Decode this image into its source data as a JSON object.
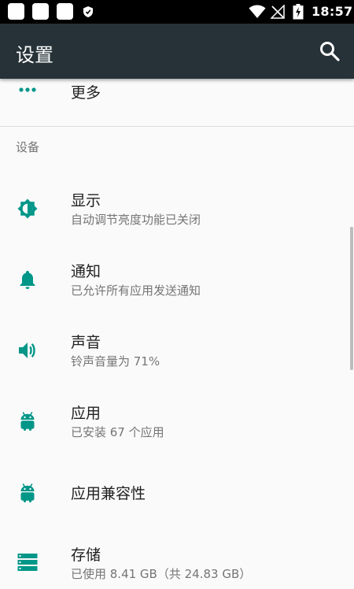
{
  "status_bar": {
    "time": "18:57"
  },
  "app_bar": {
    "title": "设置"
  },
  "more": {
    "label": "更多"
  },
  "section": {
    "header": "设备"
  },
  "items": [
    {
      "title": "显示",
      "summary": "自动调节亮度功能已关闭",
      "icon": "brightness-icon"
    },
    {
      "title": "通知",
      "summary": "已允许所有应用发送通知",
      "icon": "bell-icon"
    },
    {
      "title": "声音",
      "summary": "铃声音量为 71%",
      "icon": "volume-icon"
    },
    {
      "title": "应用",
      "summary": "已安装 67 个应用",
      "icon": "android-icon"
    },
    {
      "title": "应用兼容性",
      "summary": "",
      "icon": "android-icon"
    },
    {
      "title": "存储",
      "summary": "已使用 8.41 GB（共 24.83 GB）",
      "icon": "storage-icon"
    }
  ],
  "colors": {
    "accent": "#009688",
    "app_bar": "#263238",
    "background": "#fafafa"
  }
}
